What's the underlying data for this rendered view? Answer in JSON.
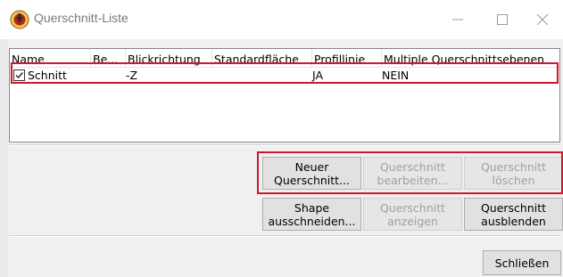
{
  "window": {
    "title": "Querschnitt-Liste",
    "minimize_glyph": "—",
    "maximize_glyph": "☐",
    "close_glyph": "✕"
  },
  "list": {
    "columns": [
      "Name",
      "Be...",
      "Blickrichtung",
      "Standardfläche",
      "Profillinie",
      "Multiple Querschnittsebenen"
    ],
    "rows": [
      {
        "checked": true,
        "name": "Schnitt",
        "be": "",
        "blickrichtung": "-Z",
        "standardflaeche": "",
        "profillinie": "JA",
        "multiple": "NEIN"
      }
    ]
  },
  "buttons": {
    "neuer_querschnitt": "Neuer\nQuerschnitt...",
    "querschnitt_bearbeiten": "Querschnitt\nbearbeiten...",
    "querschnitt_loeschen": "Querschnitt\nlöschen",
    "shape_ausschneiden": "Shape\nausschneiden...",
    "querschnitt_anzeigen": "Querschnitt\nanzeigen",
    "querschnitt_ausblenden": "Querschnitt\nausblenden",
    "schliessen": "Schließen"
  },
  "colors": {
    "highlight_box": "#cc1a2a",
    "disabled_text": "#a0a0a0"
  },
  "icons": {
    "app": "app-logo-icon",
    "checkbox": "checkbox-checked-icon"
  }
}
